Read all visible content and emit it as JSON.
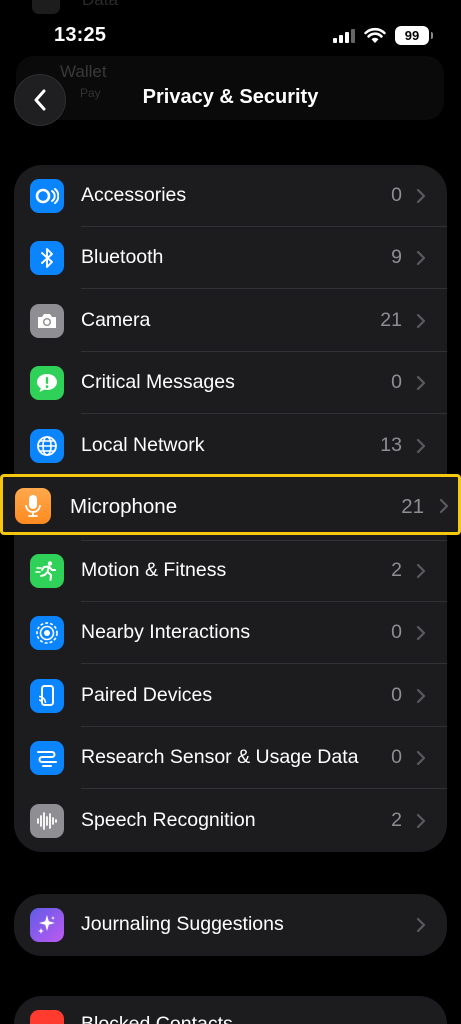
{
  "status_bar": {
    "time": "13:25",
    "battery": "99",
    "ghost_row_label": "Data",
    "icons": [
      "cellular-signal-icon",
      "wifi-icon",
      "battery-icon"
    ]
  },
  "nav": {
    "ghost_title": "Wallet",
    "ghost_subtitle": "Pay",
    "title": "Privacy & Security",
    "back_icon": "chevron-left-icon"
  },
  "main_group": {
    "items": [
      {
        "label": "Accessories",
        "count": "0",
        "icon": "accessories-icon",
        "color": "#0a84ff"
      },
      {
        "label": "Bluetooth",
        "count": "9",
        "icon": "bluetooth-icon",
        "color": "#0a84ff"
      },
      {
        "label": "Camera",
        "count": "21",
        "icon": "camera-icon",
        "color": "#8e8e93"
      },
      {
        "label": "Critical Messages",
        "count": "0",
        "icon": "critical-messages-icon",
        "color": "#30d158"
      },
      {
        "label": "Local Network",
        "count": "13",
        "icon": "globe-icon",
        "color": "#0a84ff"
      },
      {
        "label": "Microphone",
        "count": "21",
        "icon": "microphone-icon",
        "color": "#ff9f0a",
        "highlighted": true
      },
      {
        "label": "Motion & Fitness",
        "count": "2",
        "icon": "running-figure-icon",
        "color": "#30d158"
      },
      {
        "label": "Nearby Interactions",
        "count": "0",
        "icon": "nearby-interactions-icon",
        "color": "#0a84ff"
      },
      {
        "label": "Paired Devices",
        "count": "0",
        "icon": "paired-devices-icon",
        "color": "#0a84ff"
      },
      {
        "label": "Research Sensor & Usage Data",
        "count": "0",
        "icon": "research-sensor-icon",
        "color": "#0a84ff"
      },
      {
        "label": "Speech Recognition",
        "count": "2",
        "icon": "waveform-icon",
        "color": "#8e8e93"
      }
    ]
  },
  "secondary_group": {
    "items": [
      {
        "label": "Journaling Suggestions",
        "icon": "sparkles-icon",
        "color": "#7d5cf5"
      }
    ]
  },
  "bottom_peek": {
    "label": "Blocked Contacts",
    "icon": "blocked-icon",
    "color": "#ff3b30"
  },
  "highlight_color": "#f6c70f"
}
